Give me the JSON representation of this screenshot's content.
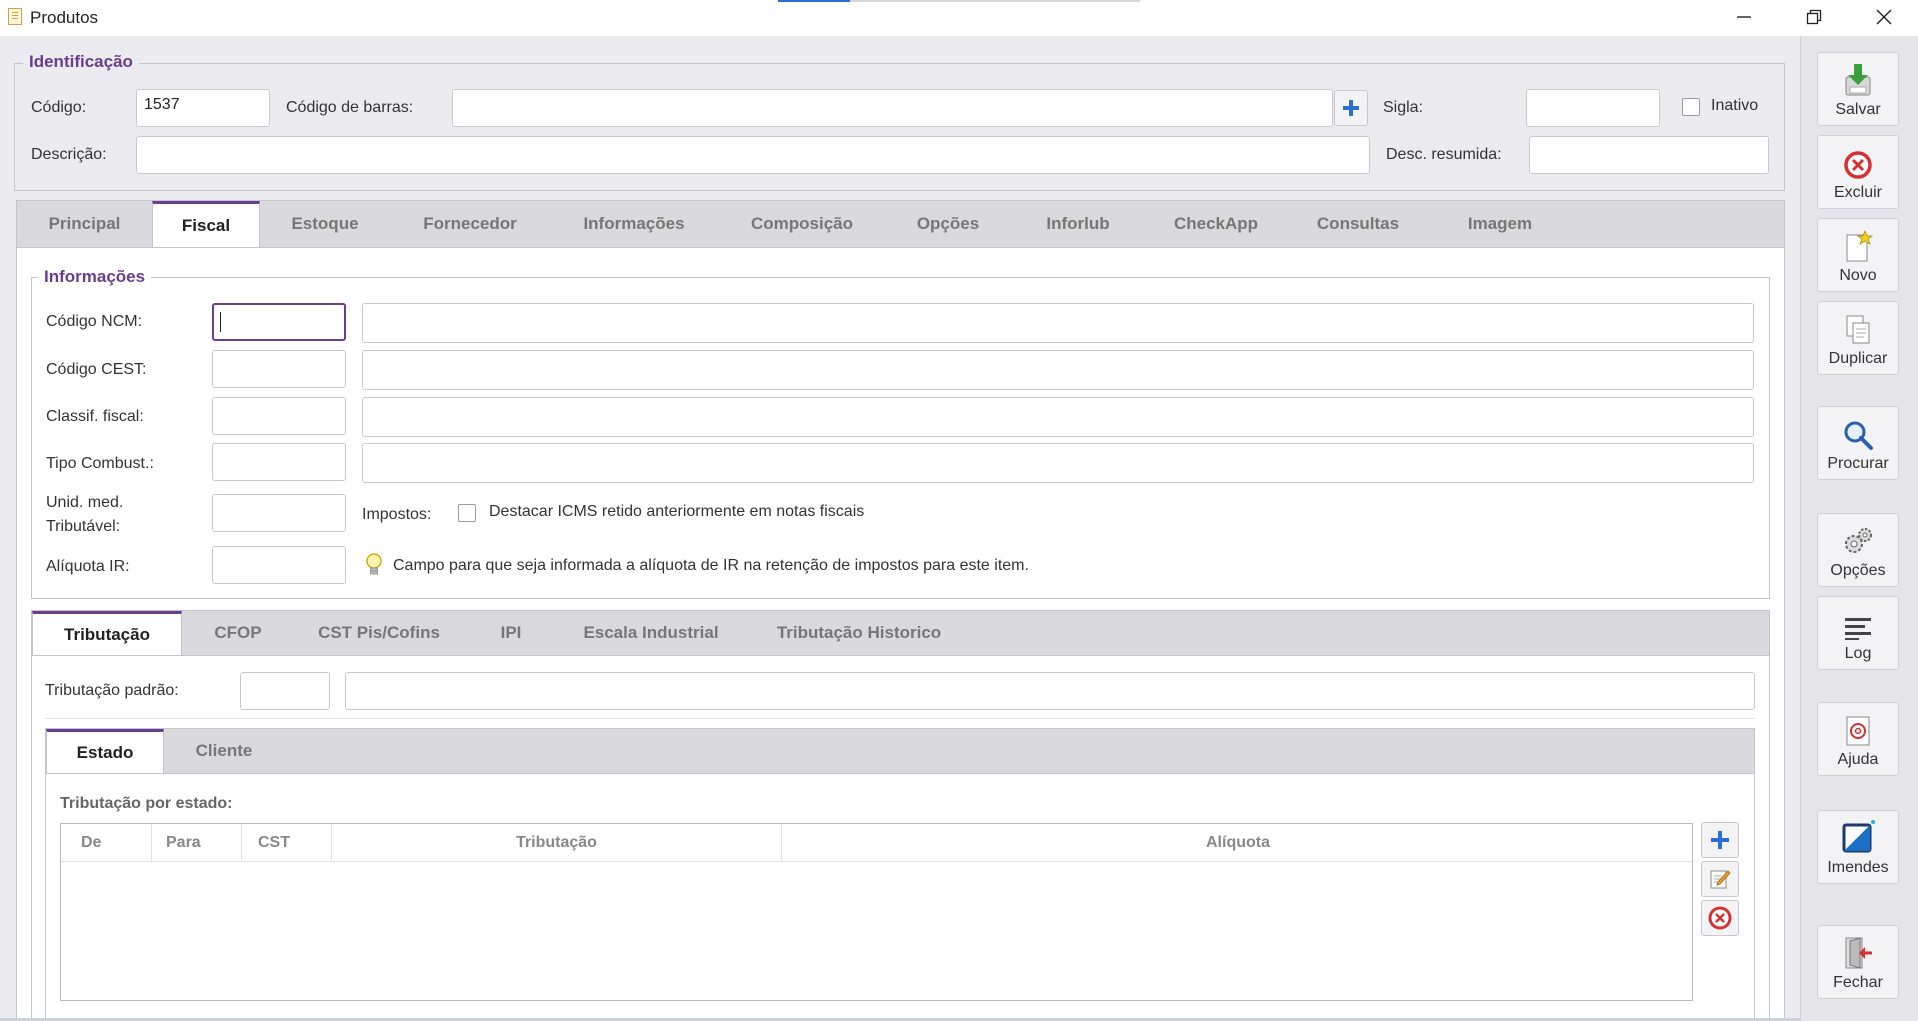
{
  "window": {
    "title": "Produtos"
  },
  "identificacao": {
    "title": "Identificação",
    "codigo_label": "Código:",
    "codigo_value": "1537",
    "barras_label": "Código de barras:",
    "sigla_label": "Sigla:",
    "inativo_label": "Inativo",
    "descricao_label": "Descrição:",
    "desc_resumida_label": "Desc. resumida:"
  },
  "main_tabs": [
    "Principal",
    "Fiscal",
    "Estoque",
    "Fornecedor",
    "Informações",
    "Composição",
    "Opções",
    "Inforlub",
    "CheckApp",
    "Consultas",
    "Imagem"
  ],
  "informacoes": {
    "title": "Informações",
    "ncm_label": "Código NCM:",
    "cest_label": "Código CEST:",
    "classif_label": "Classif. fiscal:",
    "combust_label": "Tipo Combust.:",
    "unid_label_1": "Unid. med.",
    "unid_label_2": "Tributável:",
    "impostos_label": "Impostos:",
    "destacar_label": "Destacar ICMS retido anteriormente em notas fiscais",
    "aliquota_label": "Alíquota IR:",
    "aliquota_hint": "Campo para que seja informada a alíquota de IR na retenção de impostos para este item."
  },
  "sub_tabs": [
    "Tributação",
    "CFOP",
    "CST Pis/Cofins",
    "IPI",
    "Escala Industrial",
    "Tributação Historico"
  ],
  "tributacao": {
    "padrao_label": "Tributação padrão:",
    "inner_tabs": [
      "Estado",
      "Cliente"
    ],
    "por_estado_label": "Tributação por estado:",
    "columns": [
      "De",
      "Para",
      "CST",
      "Tributação",
      "Alíquota"
    ]
  },
  "sidebar": {
    "salvar": "Salvar",
    "excluir": "Excluir",
    "novo": "Novo",
    "duplicar": "Duplicar",
    "procurar": "Procurar",
    "opcoes": "Opções",
    "log": "Log",
    "ajuda": "Ajuda",
    "imendes": "Imendes",
    "fechar": "Fechar"
  },
  "colors": {
    "accent": "#6b3d8f",
    "focus": "#6b3d8f",
    "add": "#2a6fd6",
    "delete": "#d63030"
  }
}
